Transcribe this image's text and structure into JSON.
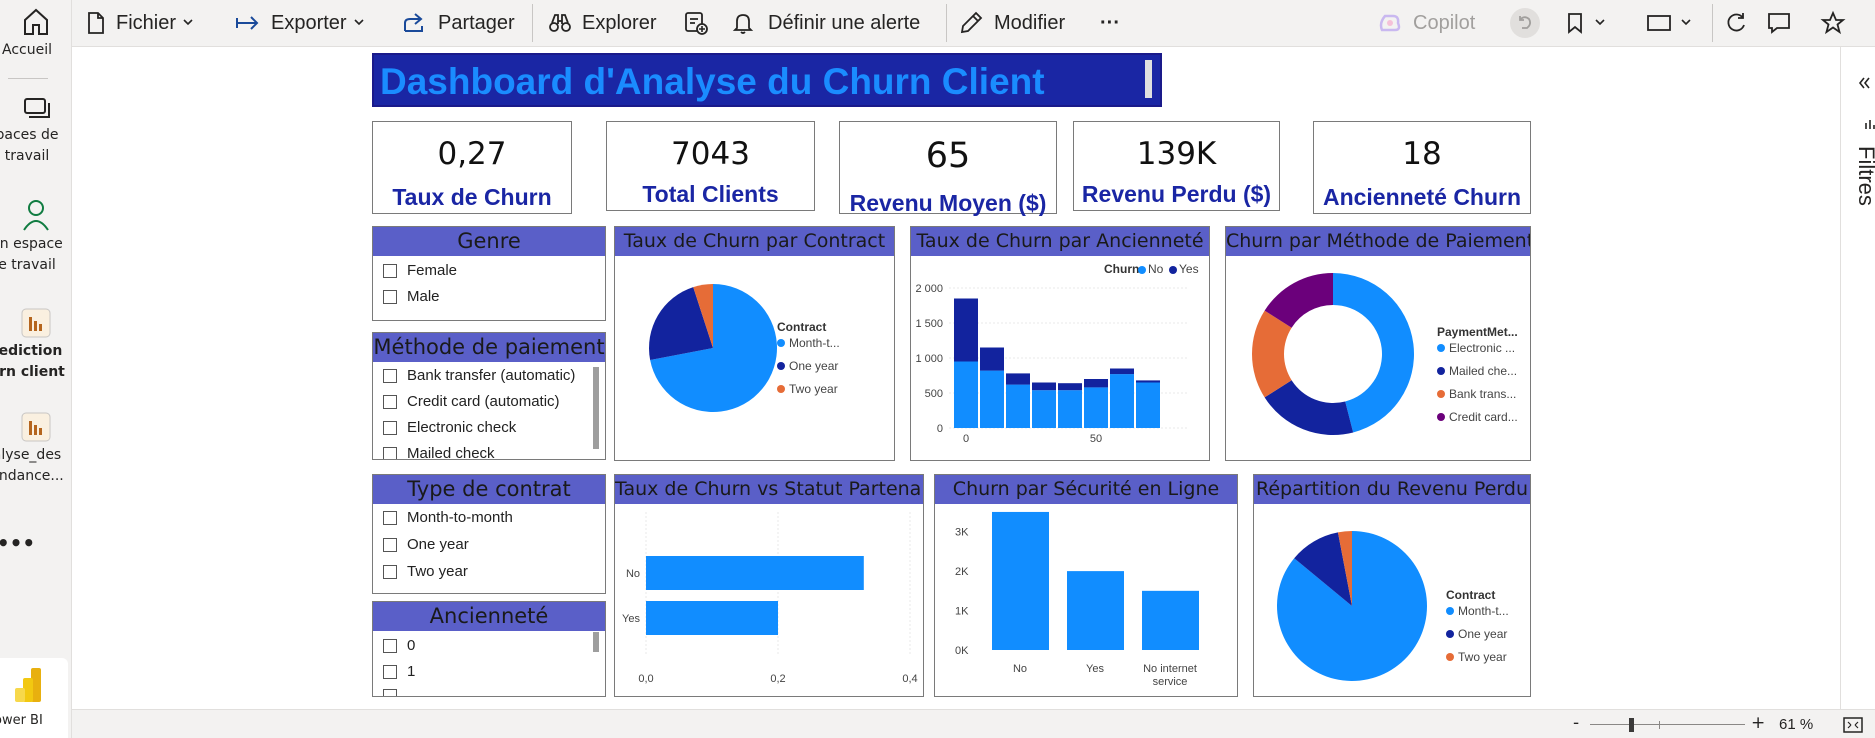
{
  "nav": {
    "items": [
      {
        "label": "Accueil",
        "icon": "home-icon"
      },
      {
        "label": "paces de\ntravail",
        "icon": "workspaces-icon"
      },
      {
        "label": "on espace\ne travail",
        "icon": "my-workspace-icon"
      },
      {
        "label": "rediction\nurn client",
        "icon": "report-icon"
      },
      {
        "label": "alyse_des\nendance...",
        "icon": "report-icon"
      }
    ],
    "more": "•••",
    "app_label": "ower BI"
  },
  "toolbar": {
    "fichier": "Fichier",
    "exporter": "Exporter",
    "partager": "Partager",
    "explorer": "Explorer",
    "alerte": "Définir une alerte",
    "modifier": "Modifier",
    "more": "···",
    "copilot": "Copilot"
  },
  "filters_label": "Filtres",
  "report": {
    "title": "Dashboard d'Analyse du Churn Client",
    "kpis": [
      {
        "value": "0,27",
        "label": "Taux de Churn"
      },
      {
        "value": "7043",
        "label": "Total Clients"
      },
      {
        "value": "65",
        "label": "Revenu Moyen ($)"
      },
      {
        "value": "139K",
        "label": "Revenu Perdu ($)"
      },
      {
        "value": "18",
        "label": "Ancienneté Churn"
      }
    ],
    "slicers": {
      "genre": {
        "title": "Genre",
        "items": [
          "Female",
          "Male"
        ]
      },
      "paiement": {
        "title": "Méthode de paiement",
        "items": [
          "Bank transfer (automatic)",
          "Credit card (automatic)",
          "Electronic check",
          "Mailed check"
        ]
      },
      "contrat": {
        "title": "Type de contrat",
        "items": [
          "Month-to-month",
          "One year",
          "Two year"
        ]
      },
      "anciennete": {
        "title": "Ancienneté",
        "items": [
          "0",
          "1",
          ""
        ]
      }
    },
    "chart_titles": {
      "contract_pie": "Taux de Churn par Contract",
      "tenure_bar": "Taux de Churn par Ancienneté",
      "payment_donut": "Churn par Méthode de Paiement",
      "partner_bar": "Taux de Churn vs Statut Partenaire",
      "security_bar": "Churn par Sécurité en Ligne",
      "revenue_pie": "Répartition du Revenu Perdu"
    }
  },
  "status": {
    "minus": "-",
    "plus": "+",
    "zoom": "61 %"
  },
  "colors": {
    "blue": "#118dff",
    "navy": "#12239e",
    "orange": "#e66c37",
    "purple": "#6b007b",
    "header": "#5a5fc8",
    "title_bg": "#1a26a4"
  },
  "chart_data": [
    {
      "type": "pie",
      "title": "Taux de Churn par Contract",
      "legend_title": "Contract",
      "categories": [
        "Month-t...",
        "One year",
        "Two year"
      ],
      "values": [
        72,
        23,
        5
      ]
    },
    {
      "type": "bar",
      "title": "Taux de Churn par Ancienneté",
      "legend_title": "Churn",
      "x_ticks": [
        "0",
        "50"
      ],
      "y_ticks": [
        "0",
        "500",
        "1 000",
        "1 500",
        "2 000"
      ],
      "ylim": [
        0,
        2000
      ],
      "x": [
        0,
        10,
        20,
        30,
        40,
        50,
        60,
        70
      ],
      "series": [
        {
          "name": "No",
          "values": [
            950,
            820,
            620,
            540,
            540,
            580,
            770,
            650
          ]
        },
        {
          "name": "Yes",
          "values": [
            900,
            330,
            160,
            110,
            100,
            120,
            80,
            30
          ]
        }
      ]
    },
    {
      "type": "pie",
      "title": "Churn par Méthode de Paiement",
      "legend_title": "PaymentMet...",
      "categories": [
        "Electronic ...",
        "Mailed che...",
        "Bank trans...",
        "Credit card..."
      ],
      "values": [
        46,
        20,
        18,
        16
      ]
    },
    {
      "type": "bar",
      "title": "Taux de Churn vs Statut Partenaire",
      "categories": [
        "No",
        "Yes"
      ],
      "values": [
        0.33,
        0.2
      ],
      "x_ticks": [
        "0,0",
        "0,2",
        "0,4"
      ],
      "xlim": [
        0,
        0.4
      ]
    },
    {
      "type": "bar",
      "title": "Churn par Sécurité en Ligne",
      "categories": [
        "No",
        "Yes",
        "No internet service"
      ],
      "values": [
        3500,
        2000,
        1500
      ],
      "y_ticks": [
        "0K",
        "1K",
        "2K",
        "3K"
      ],
      "ylim": [
        0,
        3600
      ]
    },
    {
      "type": "pie",
      "title": "Répartition du Revenu Perdu",
      "legend_title": "Contract",
      "categories": [
        "Month-t...",
        "One year",
        "Two year"
      ],
      "values": [
        86,
        11,
        3
      ]
    }
  ]
}
